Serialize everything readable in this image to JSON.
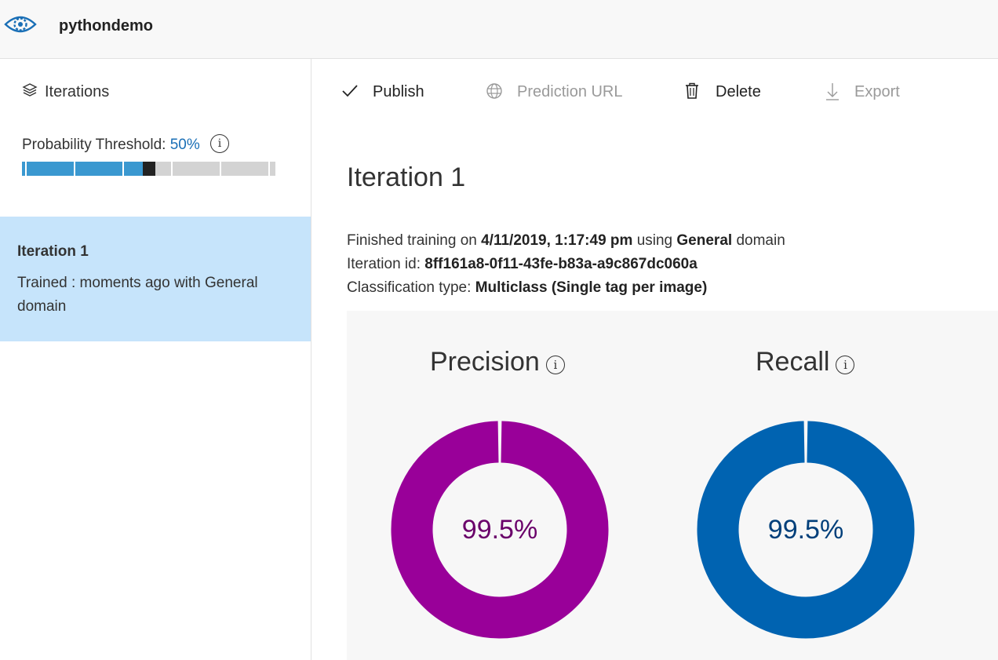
{
  "header": {
    "project_name": "pythondemo",
    "logo_icon": "eye-gear-icon"
  },
  "sidebar": {
    "iterations_label": "Iterations",
    "threshold_label": "Probability Threshold:",
    "threshold_value": "50%",
    "threshold_fraction": 0.5,
    "selected_iteration": {
      "name": "Iteration 1",
      "description": "Trained : moments ago with General domain"
    }
  },
  "toolbar": {
    "publish": "Publish",
    "prediction_url": "Prediction URL",
    "delete": "Delete",
    "export": "Export"
  },
  "main": {
    "title": "Iteration 1",
    "meta": {
      "finished_prefix": "Finished training on ",
      "finished_date": "4/11/2019, 1:17:49 pm",
      "using": " using ",
      "domain": "General",
      "domain_suffix": " domain",
      "id_label": "Iteration id: ",
      "id_value": "8ff161a8-0f11-43fe-b83a-a9c867dc060a",
      "type_label": "Classification type: ",
      "type_value": "Multiclass (Single tag per image)"
    },
    "metrics": [
      {
        "name": "Precision",
        "value": "99.5%",
        "fraction": 0.995,
        "color": "#990099",
        "text_color": "#6a006a"
      },
      {
        "name": "Recall",
        "value": "99.5%",
        "fraction": 0.995,
        "color": "#0063b1",
        "text_color": "#003f7a"
      }
    ]
  },
  "colors": {
    "accent": "#1a6fb6",
    "selected_bg": "#c6e4fb",
    "slider_fill": "#3a98d0"
  }
}
